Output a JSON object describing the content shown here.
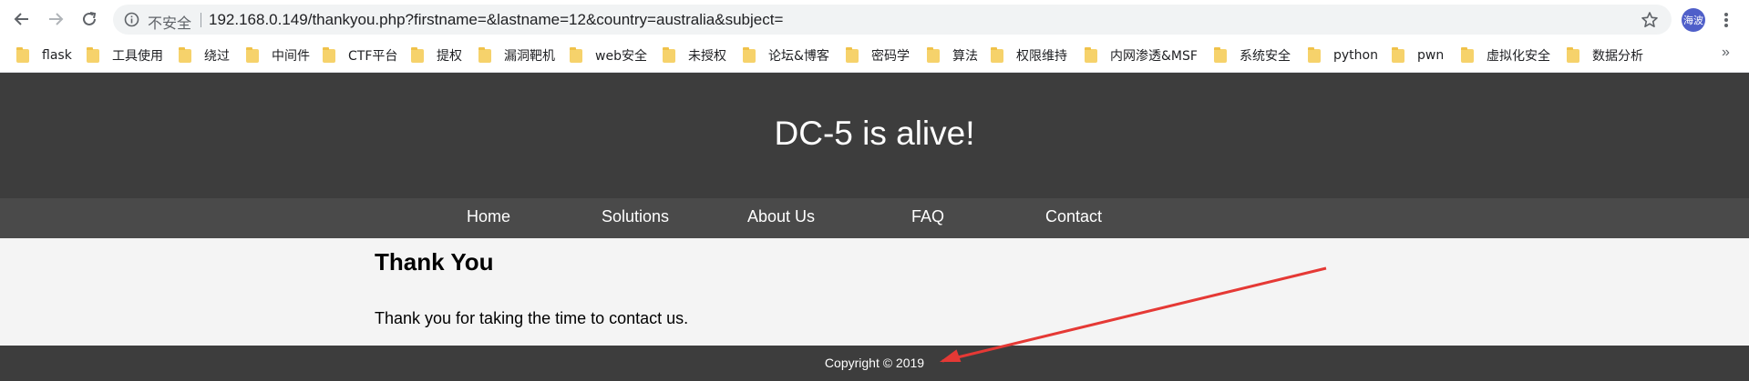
{
  "browser": {
    "back_icon": "back-arrow-icon",
    "forward_icon": "forward-arrow-icon",
    "reload_icon": "reload-icon",
    "security_label": "不安全",
    "url": "192.168.0.149/thankyou.php?firstname=&lastname=12&country=australia&subject=",
    "avatar_text": "海波",
    "more_bookmarks": "»"
  },
  "bookmarks": [
    {
      "label": "flask"
    },
    {
      "label": "工具使用"
    },
    {
      "label": "绕过"
    },
    {
      "label": "中间件"
    },
    {
      "label": "CTF平台"
    },
    {
      "label": "提权"
    },
    {
      "label": "漏洞靶机"
    },
    {
      "label": "web安全"
    },
    {
      "label": "未授权"
    },
    {
      "label": "论坛&博客"
    },
    {
      "label": "密码学"
    },
    {
      "label": "算法"
    },
    {
      "label": "权限维持"
    },
    {
      "label": "内网渗透&MSF"
    },
    {
      "label": "系统安全"
    },
    {
      "label": "python"
    },
    {
      "label": "pwn"
    },
    {
      "label": "虚拟化安全"
    },
    {
      "label": "数据分析"
    }
  ],
  "site": {
    "title": "DC-5 is alive!",
    "nav": [
      "Home",
      "Solutions",
      "About Us",
      "FAQ",
      "Contact"
    ],
    "heading": "Thank You",
    "message": "Thank you for taking the time to contact us.",
    "footer": "Copyright © 2019"
  },
  "colors": {
    "header_bg": "#3d3d3d",
    "nav_bg": "#4a4a4a",
    "content_bg": "#f4f4f4",
    "annotation_arrow": "#e53935"
  }
}
